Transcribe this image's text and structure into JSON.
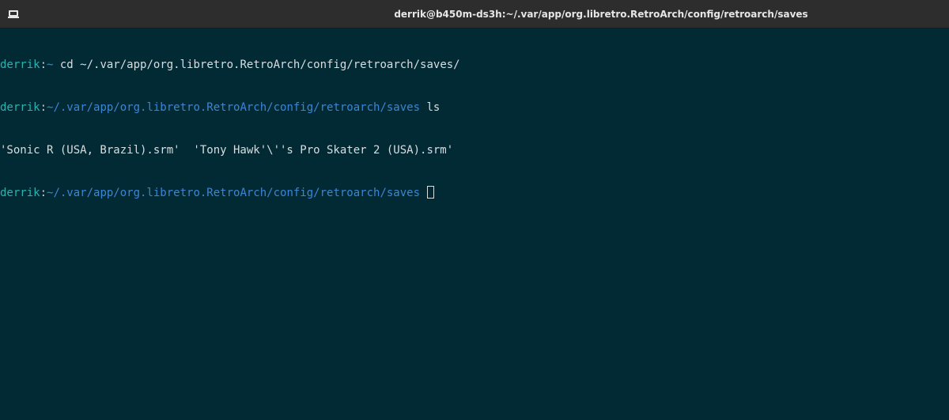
{
  "window": {
    "title": "derrik@b450m-ds3h:~/.var/app/org.libretro.RetroArch/config/retroarch/saves",
    "icon": "terminal-icon"
  },
  "terminal": {
    "lines": [
      {
        "user": "derrik",
        "sep": ":",
        "path": "~",
        "command": " cd ~/.var/app/org.libretro.RetroArch/config/retroarch/saves/"
      },
      {
        "user": "derrik",
        "sep": ":",
        "path": "~/.var/app/org.libretro.RetroArch/config/retroarch/saves",
        "command": " ls"
      },
      {
        "output": "'Sonic R (USA, Brazil).srm'  'Tony Hawk'\\''s Pro Skater 2 (USA).srm'"
      },
      {
        "user": "derrik",
        "sep": ":",
        "path": "~/.var/app/org.libretro.RetroArch/config/retroarch/saves",
        "command": " "
      }
    ]
  },
  "colors": {
    "background": "#022a35",
    "titlebar": "#2d2d2d",
    "user": "#2bb3b0",
    "path": "#3b86d4",
    "text": "#d8dee0"
  }
}
